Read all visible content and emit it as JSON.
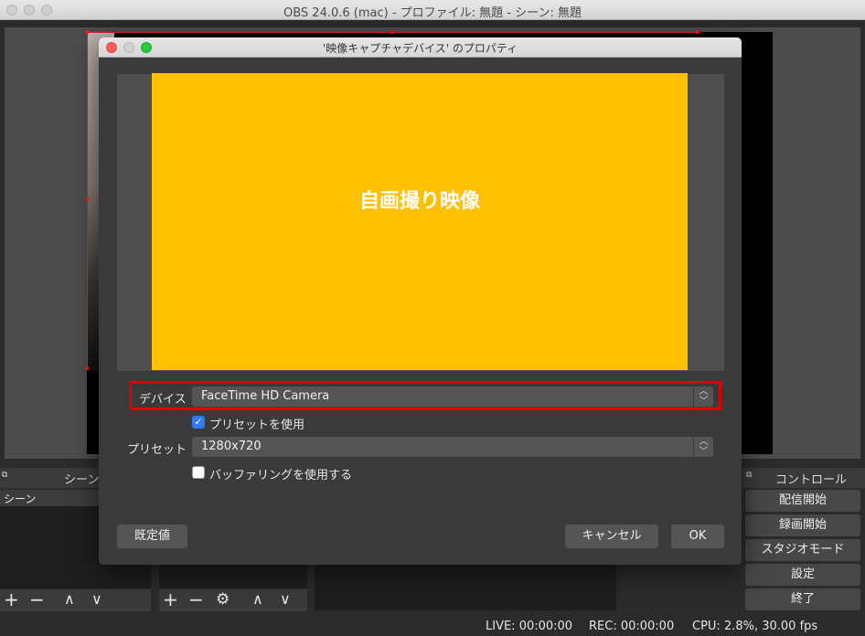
{
  "main_window": {
    "title": "OBS 24.0.6 (mac) - プロファイル: 無題 - シーン: 無題"
  },
  "docks": {
    "scenes_title": "シーン",
    "scenes_header": "シーン",
    "controls_title": "コントロール",
    "scenes_toolbar": {
      "add": "+",
      "remove": "−",
      "up": "∧",
      "down": "∨"
    },
    "sources_toolbar": {
      "add": "+",
      "remove": "−",
      "settings": "⚙",
      "up": "∧",
      "down": "∨"
    }
  },
  "controls": {
    "start_streaming": "配信開始",
    "start_recording": "録画開始",
    "studio_mode": "スタジオモード",
    "settings": "設定",
    "exit": "終了"
  },
  "status_bar": {
    "live": "LIVE: 00:00:00",
    "rec": "REC: 00:00:00",
    "cpu": "CPU: 2.8%, 30.00 fps"
  },
  "dialog": {
    "title": "'映像キャプチャデバイス' のプロパティ",
    "preview_overlay_text": "自画撮り映像",
    "device_label": "デバイス",
    "device_value": "FaceTime HD Camera",
    "use_preset_label": "プリセットを使用",
    "use_preset_checked": true,
    "preset_label": "プリセット",
    "preset_value": "1280x720",
    "use_buffering_label": "バッファリングを使用する",
    "use_buffering_checked": false,
    "defaults_button": "既定値",
    "cancel_button": "キャンセル",
    "ok_button": "OK"
  },
  "colors": {
    "highlight": "#e00000",
    "preview_fill": "#ffc000",
    "checkbox_accent": "#2f7bf5"
  }
}
